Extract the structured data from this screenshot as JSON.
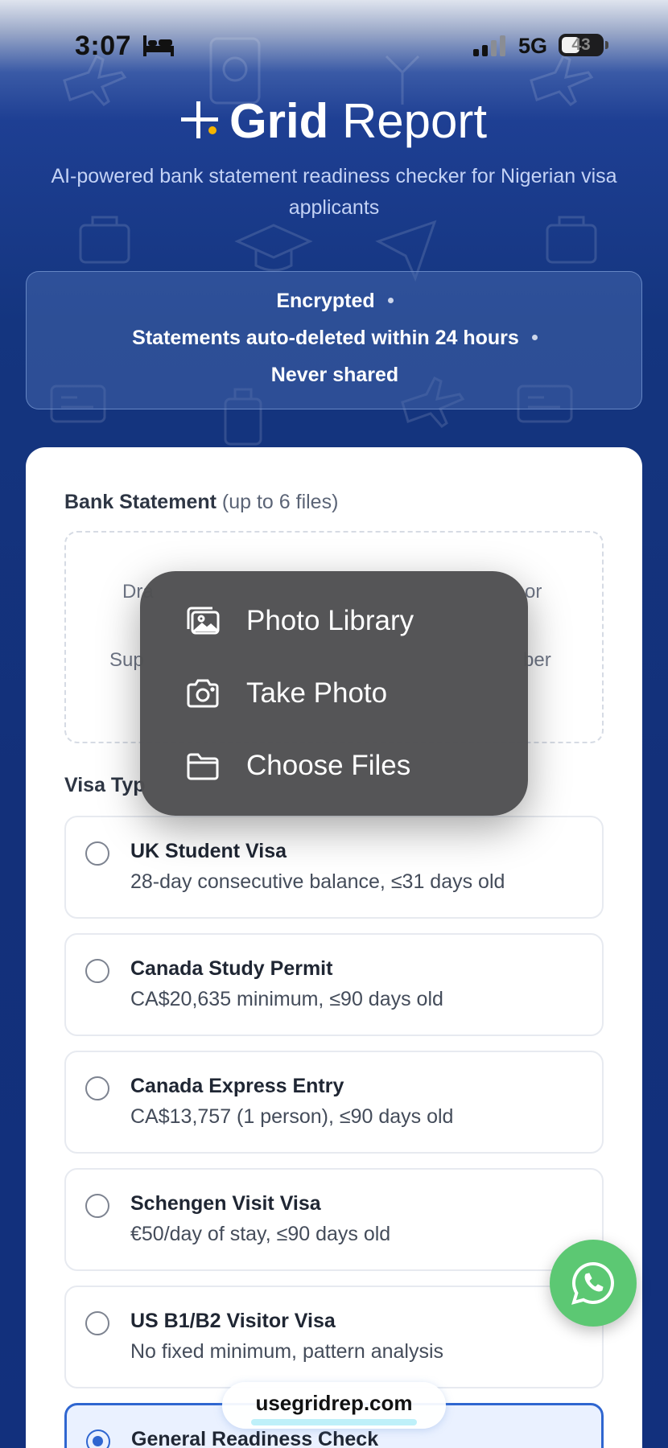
{
  "status_bar": {
    "time": "3:07",
    "network": "5G",
    "battery": "43"
  },
  "header": {
    "brand_bold": "Grid",
    "brand_rest": " Report",
    "tagline": "AI-powered bank statement readiness checker for Nigerian visa applicants"
  },
  "trust": {
    "items": [
      "Encrypted",
      "Statements auto-deleted within 24 hours",
      "Never shared"
    ]
  },
  "upload": {
    "label": "Bank Statement",
    "label_sub": "(up to 6 files)",
    "dropzone_left1": "Dra",
    "dropzone_right1": "or",
    "dropzone_left2": "Sup",
    "dropzone_right2": "ber"
  },
  "visa": {
    "label": "Visa Typ",
    "options": [
      {
        "title": "UK Student Visa",
        "desc": "28-day consecutive balance, ≤31 days old"
      },
      {
        "title": "Canada Study Permit",
        "desc": "CA$20,635 minimum, ≤90 days old"
      },
      {
        "title": "Canada Express Entry",
        "desc": "CA$13,757 (1 person), ≤90 days old"
      },
      {
        "title": "Schengen Visit Visa",
        "desc": "€50/day of stay, ≤90 days old"
      },
      {
        "title": "US B1/B2 Visitor Visa",
        "desc": "No fixed minimum, pattern analysis"
      },
      {
        "title": "General Readiness Check",
        "desc": ""
      }
    ]
  },
  "menu": {
    "items": [
      {
        "label": "Photo Library",
        "icon": "photo-library-icon"
      },
      {
        "label": "Take Photo",
        "icon": "camera-icon"
      },
      {
        "label": "Choose Files",
        "icon": "folder-icon"
      }
    ]
  },
  "footer": {
    "url": "usegridrep.com"
  },
  "colors": {
    "background": "#13307a",
    "accent": "#2f66d0",
    "whatsapp": "#5cc873",
    "logo_dot": "#f5b400"
  }
}
